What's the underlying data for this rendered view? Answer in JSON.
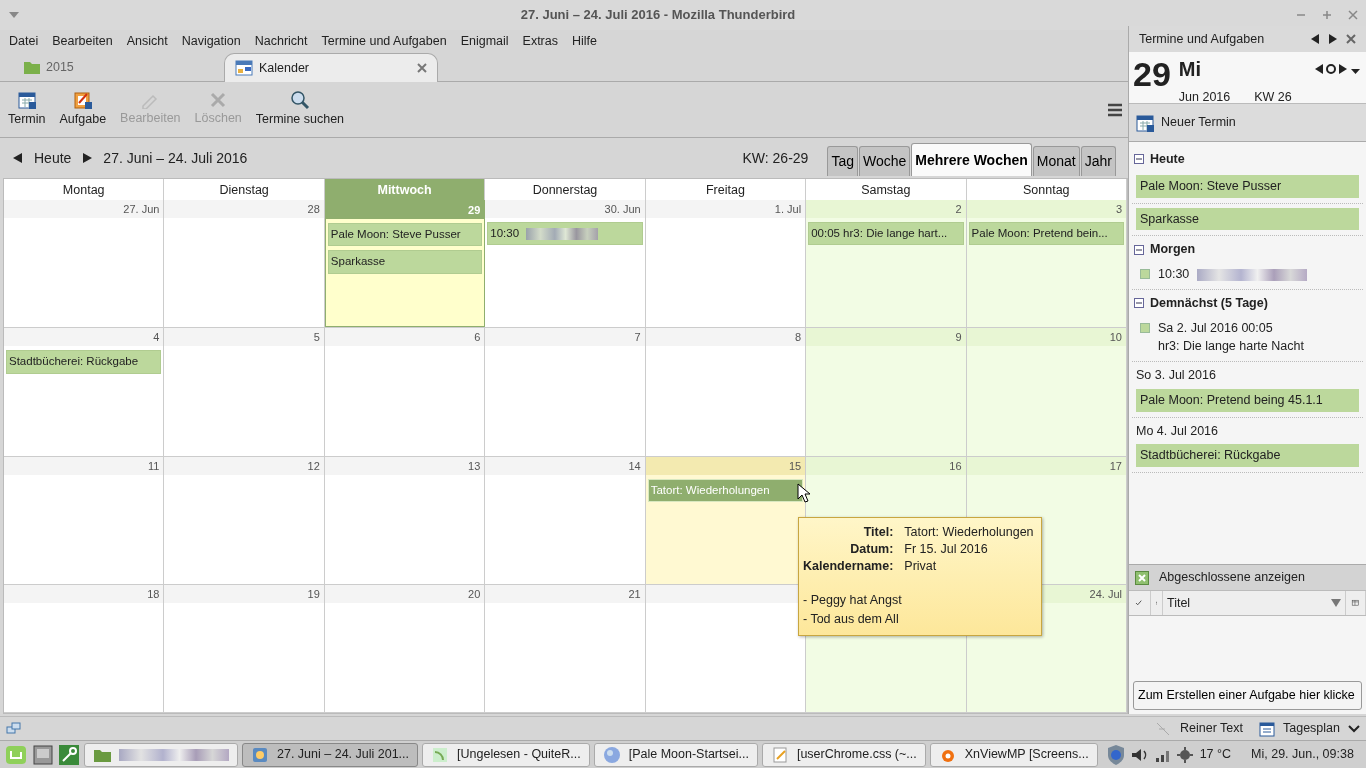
{
  "window": {
    "title": "27. Juni – 24. Juli 2016 - Mozilla Thunderbird"
  },
  "menu": [
    "Datei",
    "Bearbeiten",
    "Ansicht",
    "Navigation",
    "Nachricht",
    "Termine und Aufgaben",
    "Enigmail",
    "Extras",
    "Hilfe"
  ],
  "tabs": [
    {
      "label": "2015",
      "selected": false
    },
    {
      "label": "Kalender",
      "selected": true
    }
  ],
  "toolbar": [
    {
      "label": "Termin",
      "disabled": false
    },
    {
      "label": "Aufgabe",
      "disabled": false
    },
    {
      "label": "Bearbeiten",
      "disabled": true
    },
    {
      "label": "Löschen",
      "disabled": true
    },
    {
      "label": "Termine suchen",
      "disabled": false
    }
  ],
  "navigation": {
    "today": "Heute",
    "range": "27. Juni – 24. Juli 2016",
    "week_range": "KW: 26-29"
  },
  "views": [
    {
      "label": "Tag",
      "selected": false
    },
    {
      "label": "Woche",
      "selected": false
    },
    {
      "label": "Mehrere Wochen",
      "selected": true
    },
    {
      "label": "Monat",
      "selected": false
    },
    {
      "label": "Jahr",
      "selected": false
    }
  ],
  "weekdays": [
    {
      "label": "Montag",
      "today": false
    },
    {
      "label": "Dienstag",
      "today": false
    },
    {
      "label": "Mittwoch",
      "today": true
    },
    {
      "label": "Donnerstag",
      "today": false
    },
    {
      "label": "Freitag",
      "today": false
    },
    {
      "label": "Samstag",
      "today": false
    },
    {
      "label": "Sonntag",
      "today": false
    }
  ],
  "weeks": [
    [
      {
        "label": "27. Jun",
        "weekend": false,
        "today": false,
        "selected": false
      },
      {
        "label": "28",
        "weekend": false,
        "today": false,
        "selected": false
      },
      {
        "label": "29",
        "weekend": false,
        "today": true,
        "selected": false,
        "events": [
          {
            "title": "Pale Moon: Steve Pusser",
            "selected": false
          },
          {
            "title": "Sparkasse",
            "selected": false
          }
        ]
      },
      {
        "label": "30. Jun",
        "weekend": false,
        "today": false,
        "selected": false,
        "events": [
          {
            "title": "10:30",
            "redacted": true,
            "selected": false
          }
        ]
      },
      {
        "label": "1. Jul",
        "weekend": false,
        "today": false,
        "selected": false
      },
      {
        "label": "2",
        "weekend": true,
        "today": false,
        "selected": false,
        "events": [
          {
            "title": "00:05 hr3: Die lange hart...",
            "selected": false
          }
        ]
      },
      {
        "label": "3",
        "weekend": true,
        "today": false,
        "selected": false,
        "events": [
          {
            "title": "Pale Moon: Pretend bein...",
            "selected": false
          }
        ]
      }
    ],
    [
      {
        "label": "4",
        "weekend": false,
        "today": false,
        "selected": false,
        "events": [
          {
            "title": "Stadtbücherei: Rückgabe",
            "selected": false
          }
        ]
      },
      {
        "label": "5",
        "weekend": false,
        "today": false,
        "selected": false
      },
      {
        "label": "6",
        "weekend": false,
        "today": false,
        "selected": false
      },
      {
        "label": "7",
        "weekend": false,
        "today": false,
        "selected": false
      },
      {
        "label": "8",
        "weekend": false,
        "today": false,
        "selected": false
      },
      {
        "label": "9",
        "weekend": true,
        "today": false,
        "selected": false
      },
      {
        "label": "10",
        "weekend": true,
        "today": false,
        "selected": false
      }
    ],
    [
      {
        "label": "11",
        "weekend": false,
        "today": false,
        "selected": false
      },
      {
        "label": "12",
        "weekend": false,
        "today": false,
        "selected": false
      },
      {
        "label": "13",
        "weekend": false,
        "today": false,
        "selected": false
      },
      {
        "label": "14",
        "weekend": false,
        "today": false,
        "selected": false
      },
      {
        "label": "15",
        "weekend": false,
        "today": false,
        "selected": true,
        "events": [
          {
            "title": "Tatort: Wiederholungen",
            "selected": true
          }
        ]
      },
      {
        "label": "16",
        "weekend": true,
        "today": false,
        "selected": false
      },
      {
        "label": "17",
        "weekend": true,
        "today": false,
        "selected": false
      }
    ],
    [
      {
        "label": "18",
        "weekend": false,
        "today": false,
        "selected": false
      },
      {
        "label": "19",
        "weekend": false,
        "today": false,
        "selected": false
      },
      {
        "label": "20",
        "weekend": false,
        "today": false,
        "selected": false
      },
      {
        "label": "21",
        "weekend": false,
        "today": false,
        "selected": false
      },
      {
        "weekend": false,
        "today": false,
        "selected": false
      },
      {
        "weekend": true,
        "today": false,
        "selected": false
      },
      {
        "label": "24. Jul",
        "weekend": true,
        "today": false,
        "selected": false
      }
    ]
  ],
  "tooltip": {
    "fields": [
      {
        "label": "Titel:",
        "value": "Tatort: Wiederholungen"
      },
      {
        "label": "Datum:",
        "value": "Fr 15. Jul 2016"
      },
      {
        "label": "Kalendername:",
        "value": "Privat"
      }
    ],
    "notes": [
      "- Peggy hat Angst",
      "- Tod aus dem All"
    ]
  },
  "today_pane": {
    "title": "Termine und Aufgaben",
    "day": "29",
    "weekday": "Mi",
    "month": "Jun 2016",
    "week": "KW 26",
    "new_event": "Neuer Termin",
    "sections": [
      {
        "title": "Heute",
        "expanded": true,
        "items": [
          {
            "kind": "event",
            "title": "Pale Moon: Steve Pusser"
          },
          {
            "kind": "event",
            "title": "Sparkasse"
          }
        ]
      },
      {
        "title": "Morgen",
        "expanded": true,
        "items": [
          {
            "kind": "timed",
            "time": "10:30",
            "redacted": true
          }
        ]
      },
      {
        "title": "Demnächst (5 Tage)",
        "expanded": true,
        "items": [
          {
            "kind": "timed",
            "time": "Sa 2. Jul 2016 00:05",
            "title": "hr3: Die lange harte Nacht"
          },
          {
            "kind": "dated",
            "date": "So 3. Jul 2016",
            "title": "Pale Moon: Pretend being 45.1.1"
          },
          {
            "kind": "dated",
            "date": "Mo 4. Jul 2016",
            "title": "Stadtbücherei: Rückgabe"
          }
        ]
      }
    ],
    "show_completed": {
      "label": "Abgeschlossene anzeigen",
      "checked": true
    },
    "task_column": "Titel",
    "new_task": "Zum Erstellen einer Aufgabe hier klicke"
  },
  "status_bar": {
    "format": "Reiner Text",
    "mode": "Tagesplan"
  },
  "taskbar": {
    "windows": [
      {
        "redacted": true,
        "selected": false
      },
      {
        "title": "27. Juni – 24. Juli 201...",
        "selected": true
      },
      {
        "title": "[Ungelesen - QuiteR...",
        "selected": false
      },
      {
        "title": "[Pale Moon-Startsei...",
        "selected": false
      },
      {
        "title": "[userChrome.css (~...",
        "selected": false
      },
      {
        "title": "XnViewMP [Screens...",
        "selected": false
      }
    ],
    "temperature": "17 °C",
    "clock": "Mi, 29. Jun., 09:38"
  }
}
